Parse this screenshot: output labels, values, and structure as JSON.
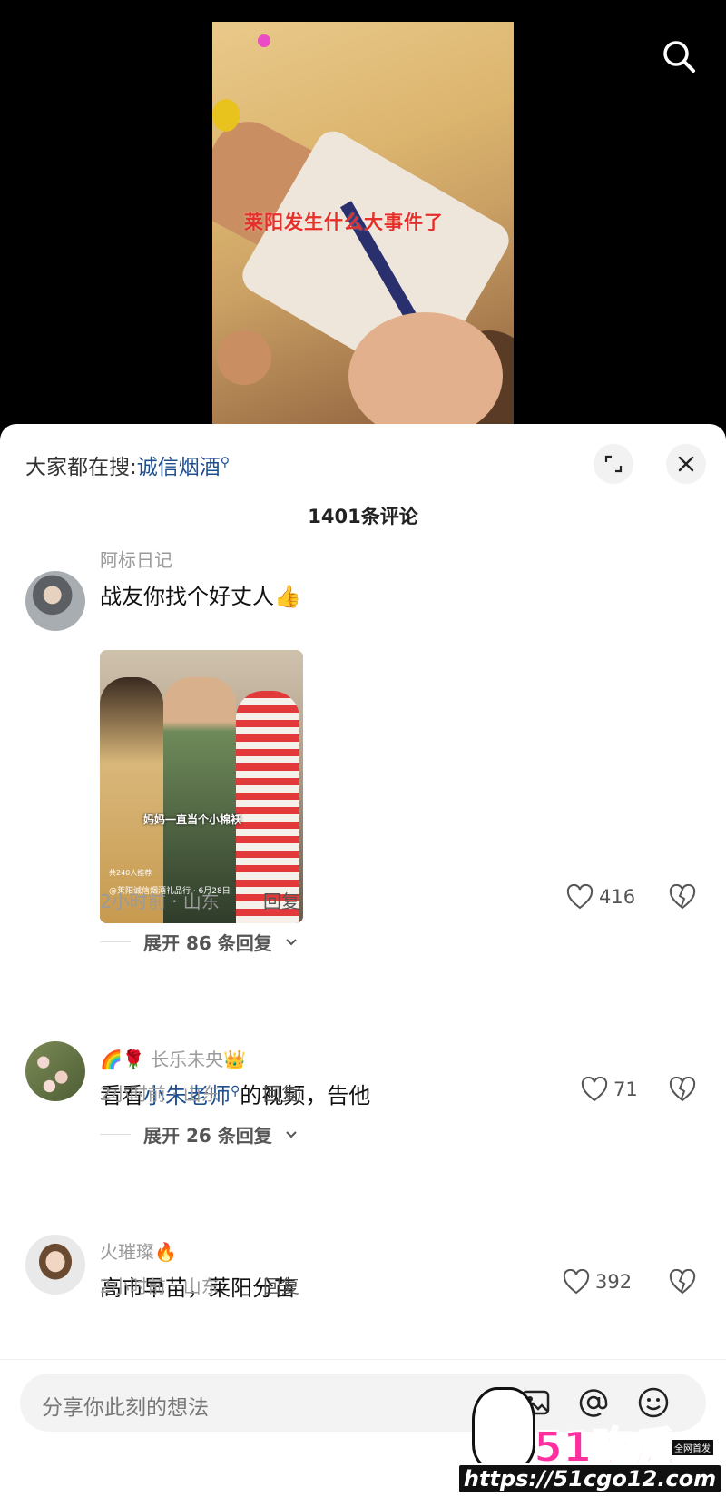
{
  "video": {
    "caption": "莱阳发生什么大事件了"
  },
  "sheet": {
    "hot_search_prefix": "大家都在搜:",
    "hot_search_keyword": "诚信烟酒",
    "comment_count": "1401条评论"
  },
  "comments": [
    {
      "username": "阿标日记",
      "text": "战友你找个好丈人👍",
      "image": {
        "caption": "妈妈一直当个小棉袄",
        "small_line1": "共240人推荐",
        "small_line2": "@莱阳诚信烟酒礼品行 · 6月28日"
      },
      "meta": "2小时前 · 山东",
      "reply_label": "回复",
      "likes": "416",
      "expand_label": "展开 86 条回复"
    },
    {
      "username_prefix": "🌈🌹",
      "username": "长乐未央",
      "username_suffix": "👑",
      "text_before": "看看",
      "text_keyword": "小朱老师",
      "text_after": "的视频，告他",
      "meta": "2小时前 · 山东",
      "reply_label": "回复",
      "likes": "71",
      "expand_label": "展开 26 条回复"
    },
    {
      "username": "火璀璨",
      "username_suffix": "🔥",
      "text": "高市早苗，莱阳分苗",
      "meta": "2小时前 · 山东",
      "reply_label": "回复",
      "likes": "392"
    }
  ],
  "input": {
    "placeholder": "分享你此刻的想法"
  },
  "watermark": {
    "logo": "51吃瓜",
    "tag": "全网首发",
    "url": "https://51cgo12.com"
  },
  "icons": {
    "search": "search-icon",
    "expand": "expand-icon",
    "close": "close-icon",
    "heart": "heart-icon",
    "broken_heart": "broken-heart-icon",
    "chevron": "chevron-down-icon",
    "image": "image-icon",
    "at": "at-icon",
    "emoji": "emoji-icon"
  }
}
